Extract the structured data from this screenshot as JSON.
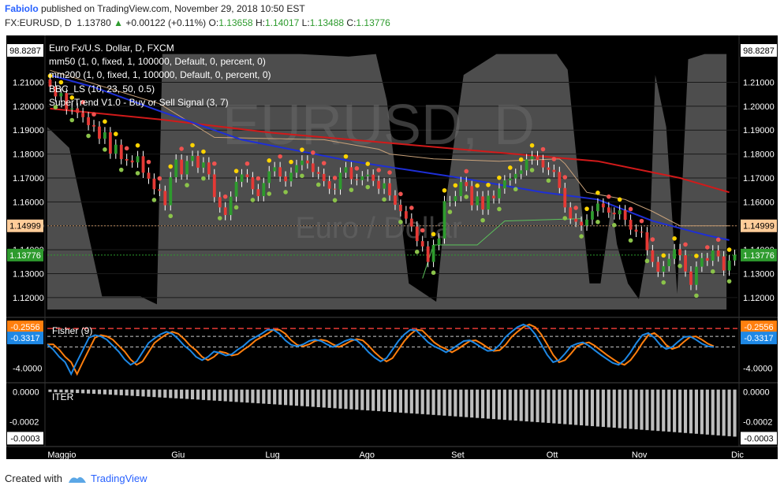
{
  "header": {
    "author": "Fabiolo",
    "published_text": "published on TradingView.com, November 29, 2018 10:50 EST",
    "symbol_line": "FX:EURUSD, D",
    "last": "1.13780",
    "change": "+0.00122 (+0.11%)",
    "o_label": "O:",
    "o_value": "1.13658",
    "h_label": "H:",
    "h_value": "1.14017",
    "l_label": "L:",
    "l_value": "1.13488",
    "c_label": "C:",
    "c_value": "1.13776"
  },
  "colors": {
    "up": "#2e9b2e",
    "down": "#e53935",
    "sma50": "#1e2fd6",
    "sma200": "#d11a1a",
    "dot_yellow": "#ffd400",
    "dot_red": "#ef5350",
    "dot_green": "#8bc34a",
    "fisher_blue": "#1e88e5",
    "fisher_orange": "#ff7f0e",
    "band": "#5a5a5a"
  },
  "chart_data": [
    {
      "type": "candlestick",
      "title": "Euro Fx/U.S. Dollar, D, FXCM",
      "watermark": "EURUSD, D",
      "watermark_sub": "Euro / Dollar",
      "indicators": [
        "mm50 (1, 0, fixed, 1, 100000, Default, 0, percent, 0)",
        "mm200 (1, 0, fixed, 1, 100000, Default, 0, percent, 0)",
        "BBC_LS (10, 23, 50, 0.5)",
        "SuperTrend V1.0 - Buy or Sell Signal (3, 7)"
      ],
      "y_ticks": [
        "1.21000",
        "1.20000",
        "1.19000",
        "1.18000",
        "1.17000",
        "1.16000",
        "1.15000",
        "1.14000",
        "1.13000",
        "1.12000"
      ],
      "ylim": [
        1.115,
        1.224
      ],
      "top_left_badge": "98.8287",
      "top_right_badge": "98.8287",
      "price_badge_1": "1.14999",
      "price_badge_2": "1.13776",
      "x_labels": [
        "Maggio",
        "Giu",
        "Lug",
        "Ago",
        "Set",
        "Ott",
        "Nov",
        "Dic"
      ],
      "closes": [
        1.2082,
        1.2041,
        1.2055,
        1.1987,
        1.1991,
        1.1972,
        1.1954,
        1.1921,
        1.1915,
        1.1864,
        1.1891,
        1.1802,
        1.1839,
        1.1779,
        1.1773,
        1.1765,
        1.1791,
        1.1722,
        1.1697,
        1.1653,
        1.1646,
        1.1586,
        1.1703,
        1.1777,
        1.1715,
        1.1771,
        1.1792,
        1.1743,
        1.1765,
        1.1715,
        1.162,
        1.1577,
        1.1545,
        1.1622,
        1.1684,
        1.1715,
        1.1703,
        1.1653,
        1.1624,
        1.1679,
        1.1728,
        1.1745,
        1.1706,
        1.1686,
        1.1722,
        1.1754,
        1.1773,
        1.1761,
        1.1725,
        1.1717,
        1.1687,
        1.1655,
        1.1652,
        1.1722,
        1.1745,
        1.1695,
        1.1691,
        1.1707,
        1.1714,
        1.1688,
        1.1655,
        1.1678,
        1.1627,
        1.1588,
        1.1561,
        1.153,
        1.1497,
        1.1436,
        1.1414,
        1.1349,
        1.142,
        1.1447,
        1.1603,
        1.1603,
        1.1624,
        1.1683,
        1.1666,
        1.1586,
        1.1623,
        1.1568,
        1.1626,
        1.1615,
        1.1656,
        1.169,
        1.1698,
        1.1717,
        1.1732,
        1.1778,
        1.1791,
        1.1775,
        1.1744,
        1.1734,
        1.1725,
        1.1658,
        1.1577,
        1.153,
        1.1517,
        1.1501,
        1.1526,
        1.1561,
        1.1593,
        1.1577,
        1.1555,
        1.1548,
        1.1565,
        1.1525,
        1.1484,
        1.1475,
        1.1473,
        1.1398,
        1.1349,
        1.1308,
        1.1331,
        1.1362,
        1.1402,
        1.1377,
        1.1309,
        1.1253,
        1.1329,
        1.1365,
        1.1354,
        1.1397,
        1.1372,
        1.1313,
        1.1355,
        1.1378
      ],
      "sma50_curve": [
        [
          0,
          1.213
        ],
        [
          8,
          1.208
        ],
        [
          20,
          1.198
        ],
        [
          35,
          1.186
        ],
        [
          55,
          1.177
        ],
        [
          75,
          1.17
        ],
        [
          90,
          1.164
        ],
        [
          100,
          1.161
        ],
        [
          110,
          1.152
        ],
        [
          120,
          1.146
        ],
        [
          124,
          1.144
        ]
      ],
      "sma200_curve": [
        [
          0,
          1.199
        ],
        [
          20,
          1.1945
        ],
        [
          40,
          1.189
        ],
        [
          60,
          1.185
        ],
        [
          80,
          1.181
        ],
        [
          100,
          1.177
        ],
        [
          115,
          1.17
        ],
        [
          124,
          1.164
        ]
      ]
    },
    {
      "type": "line",
      "title": "Fisher (9)",
      "series": [
        {
          "values": [
            -0.4,
            -1.2,
            -2.3,
            -3.1,
            -4.9,
            -3.0,
            -1.2,
            0.6,
            1.0,
            0.8,
            0.3,
            -0.6,
            -1.5,
            -2.7,
            -3.5,
            -3.0,
            -1.6,
            -0.2,
            0.5,
            1.1,
            1.5,
            1.2,
            0.4,
            -0.6,
            -1.3,
            -2.3,
            -2.8,
            -2.3,
            -1.5,
            -1.7,
            -2.1,
            -1.9,
            -1.2,
            -0.6,
            0.2,
            0.7,
            1.2,
            1.8,
            1.8,
            1.2,
            0.2,
            -0.5,
            -0.7,
            -0.4,
            0.1,
            0.3,
            0.1,
            -0.4,
            -0.8,
            -0.4,
            0.1,
            0.4,
            0.2,
            -0.6,
            -1.6,
            -2.4,
            -3.0,
            -2.5,
            -1.2,
            0.1,
            1.1,
            1.8,
            1.7,
            0.8,
            -0.1,
            -0.7,
            -1.1,
            -1.6,
            -1.1,
            -0.5,
            0.1,
            0.2,
            -0.3,
            -0.9,
            -1.4,
            -1.3,
            -0.5,
            0.7,
            1.5,
            2.2,
            2.6,
            2.2,
            1.1,
            -0.4,
            -2.0,
            -3.1,
            -2.8,
            -1.8,
            -0.7,
            -0.3,
            -0.1,
            -0.6,
            -1.3,
            -2.0,
            -2.6,
            -3.2,
            -3.5,
            -2.8,
            -1.6,
            -0.2,
            1.0,
            1.3,
            0.6,
            -0.5,
            -1.1,
            -0.8,
            0.0,
            0.7,
            0.8,
            0.3,
            -0.3,
            -0.7,
            -0.8
          ]
        }
      ],
      "ylim": [
        -5.5,
        3.2
      ],
      "y_tick": "-4.0000",
      "badge_1": "-0.2556",
      "badge_2": "-0.3317"
    },
    {
      "type": "bar",
      "title": "ITER",
      "y_ticks": [
        "0.0000",
        "-0.0002"
      ],
      "badge": "-0.0003",
      "ylim": [
        -0.00034,
        3e-05
      ]
    }
  ],
  "footer": {
    "created_with": "Created with",
    "brand": "TradingView"
  }
}
